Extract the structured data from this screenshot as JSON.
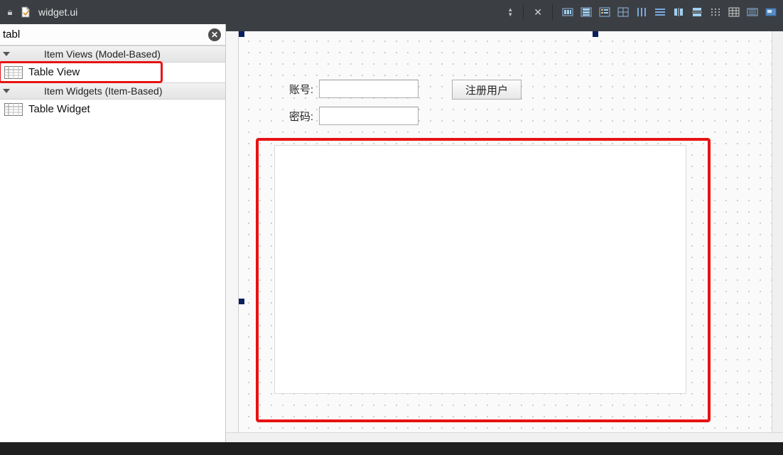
{
  "topbar": {
    "filename": "widget.ui",
    "close_tooltip": "Close",
    "tools": [
      "layout-horizontal",
      "layout-vertical",
      "layout-form",
      "layout-grid",
      "col-layout",
      "row-layout",
      "h-splitter",
      "v-splitter",
      "grid-dots",
      "grid-lines",
      "break-layout",
      "preview"
    ]
  },
  "widgetbox": {
    "filter_value": "tabl",
    "categories": [
      {
        "label": "Item Views (Model-Based)",
        "items": [
          {
            "label": "Table View"
          }
        ]
      },
      {
        "label": "Item Widgets (Item-Based)",
        "items": [
          {
            "label": "Table Widget"
          }
        ]
      }
    ]
  },
  "form": {
    "account_label": "账号:",
    "password_label": "密码:",
    "register_button": "注册用户",
    "account_value": "",
    "password_value": ""
  }
}
